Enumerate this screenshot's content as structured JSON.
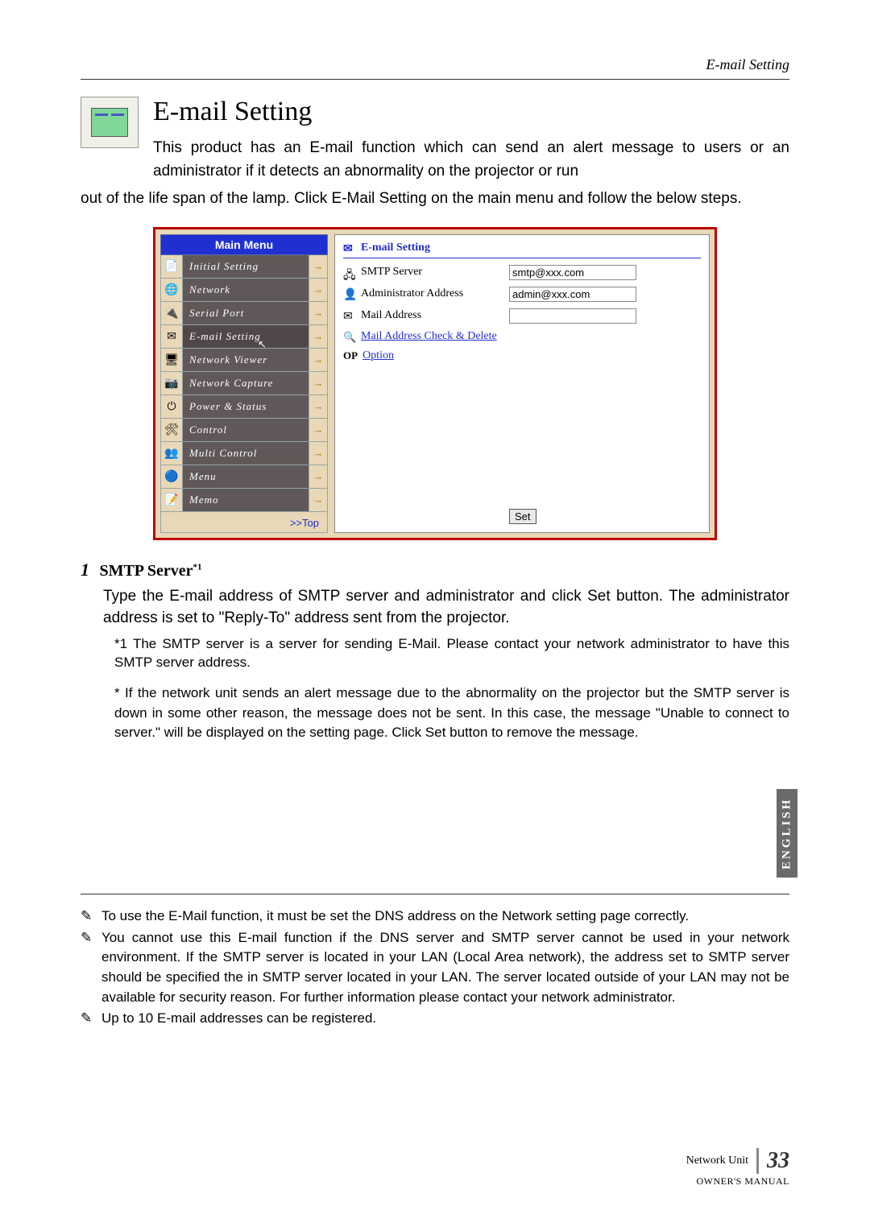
{
  "header": {
    "right": "E-mail Setting"
  },
  "title": "E-mail Setting",
  "intro_a": "This product has an E-mail function which can send an alert message to users or an administrator if it detects an abnormality on the projector or run",
  "intro_b": "out of the life span of the lamp. Click E-Mail Setting on the main menu and follow the below steps.",
  "screenshot": {
    "menu_header": "Main Menu",
    "items": [
      {
        "label": "Initial Setting",
        "icon": "📄"
      },
      {
        "label": "Network",
        "icon": "🌐"
      },
      {
        "label": "Serial Port",
        "icon": "🔌"
      },
      {
        "label": "E-mail Setting",
        "icon": "✉",
        "selected": true,
        "cursor": true
      },
      {
        "label": "Network Viewer",
        "icon": "🖥"
      },
      {
        "label": "Network Capture",
        "icon": "📷"
      },
      {
        "label": "Power & Status",
        "icon": "⏻"
      },
      {
        "label": "Control",
        "icon": "🛠"
      },
      {
        "label": "Multi Control",
        "icon": "👥"
      },
      {
        "label": "Menu",
        "icon": "🔵"
      },
      {
        "label": "Memo",
        "icon": "📝"
      }
    ],
    "top_link": ">>Top",
    "pane": {
      "title": "E-mail Setting",
      "fields": {
        "smtp": {
          "label": "SMTP Server",
          "value": "smtp@xxx.com"
        },
        "admin": {
          "label": "Administrator Address",
          "value": "admin@xxx.com"
        },
        "mail": {
          "label": "Mail Address",
          "value": ""
        }
      },
      "links": {
        "check": "Mail Address Check & Delete",
        "option": "Option",
        "option_prefix": "OP"
      },
      "set": "Set"
    }
  },
  "step1": {
    "num": "1",
    "title": "SMTP Server",
    "sup": "*1",
    "body": "Type the E-mail address of SMTP server and administrator and click Set button. The administrator address is set to \"Reply-To\" address sent from the projector.",
    "fn1": "*1 The SMTP server is a server for sending E-Mail. Please contact your network administrator to have this SMTP server address.",
    "fn_star": "* If the network unit sends an alert message due to the abnormality on the projector but the SMTP server is down in some other reason, the message does not be sent. In this case, the message \"Unable to connect to server.\" will be displayed on the setting page. Click Set button to remove the message."
  },
  "sidetab": "ENGLISH",
  "notes": {
    "n1": "To use the E-Mail function, it must be set the DNS address on the Network setting page correctly.",
    "n2": "You cannot use this E-mail function if the DNS server and SMTP server cannot be used in your network environment. If the SMTP server is located in your LAN (Local Area network), the address set to SMTP server should be specified the in SMTP server located in your LAN. The server located outside of your LAN may not be available for security reason. For further information please contact your network administrator.",
    "n3": "Up to 10 E-mail addresses can be registered."
  },
  "footer": {
    "unit": "Network Unit",
    "page": "33",
    "manual": "OWNER'S MANUAL"
  }
}
